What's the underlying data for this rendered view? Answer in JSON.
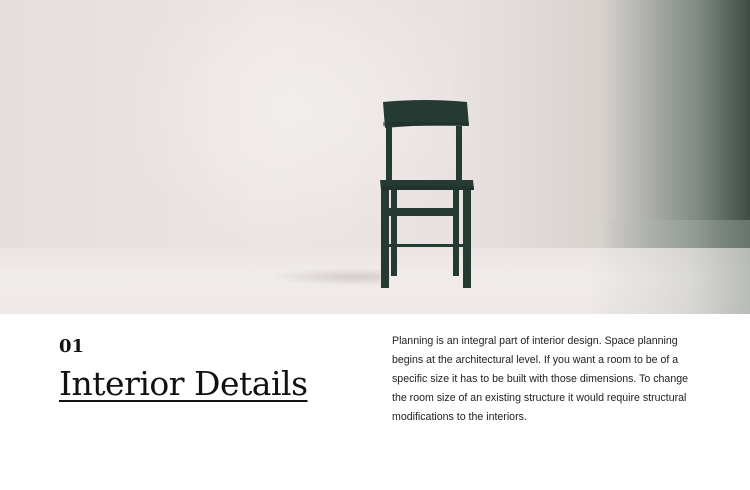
{
  "hero": {
    "image": "empty-room-wooden-chair",
    "colors": {
      "wall": "#e9e2e1",
      "chair": "#243a33",
      "shadow_edge": "#3f4c46"
    }
  },
  "section": {
    "number": "01",
    "title": "Interior Details",
    "description": "Planning is an integral part of interior design. Space planning begins at the architectural level. If you want a room to be of a specific size it has to be built with those dimensions. To change the room size of an existing structure it would require structural modifications to the interiors."
  }
}
